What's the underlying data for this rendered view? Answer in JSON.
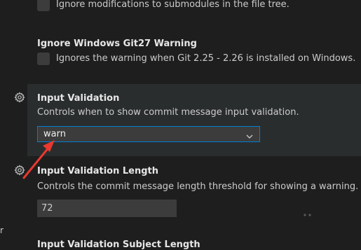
{
  "settings": {
    "ignore_submodules": {
      "description": "Ignore modifications to submodules in the file tree."
    },
    "ignore_windows_git27": {
      "title": "Ignore Windows Git27 Warning",
      "description": "Ignores the warning when Git 2.25 - 2.26 is installed on Windows."
    },
    "input_validation": {
      "title": "Input Validation",
      "description": "Controls when to show commit message input validation.",
      "selected_value": "warn"
    },
    "input_validation_length": {
      "title": "Input Validation Length",
      "description": "Controls the commit message length threshold for showing a warning.",
      "value": "72"
    },
    "input_validation_subject_length": {
      "title": "Input Validation Subject Length"
    }
  },
  "edge_fragments": {
    "left_letter": "r"
  },
  "icons": {
    "gear": "gear-icon",
    "chevron": "chevron-down-icon"
  },
  "colors": {
    "background": "#1e1e1e",
    "focus_row": "#2a2d2e",
    "input_background": "#3c3c3c",
    "focus_border": "#007fd4",
    "annotation_arrow": "#e8382f"
  }
}
